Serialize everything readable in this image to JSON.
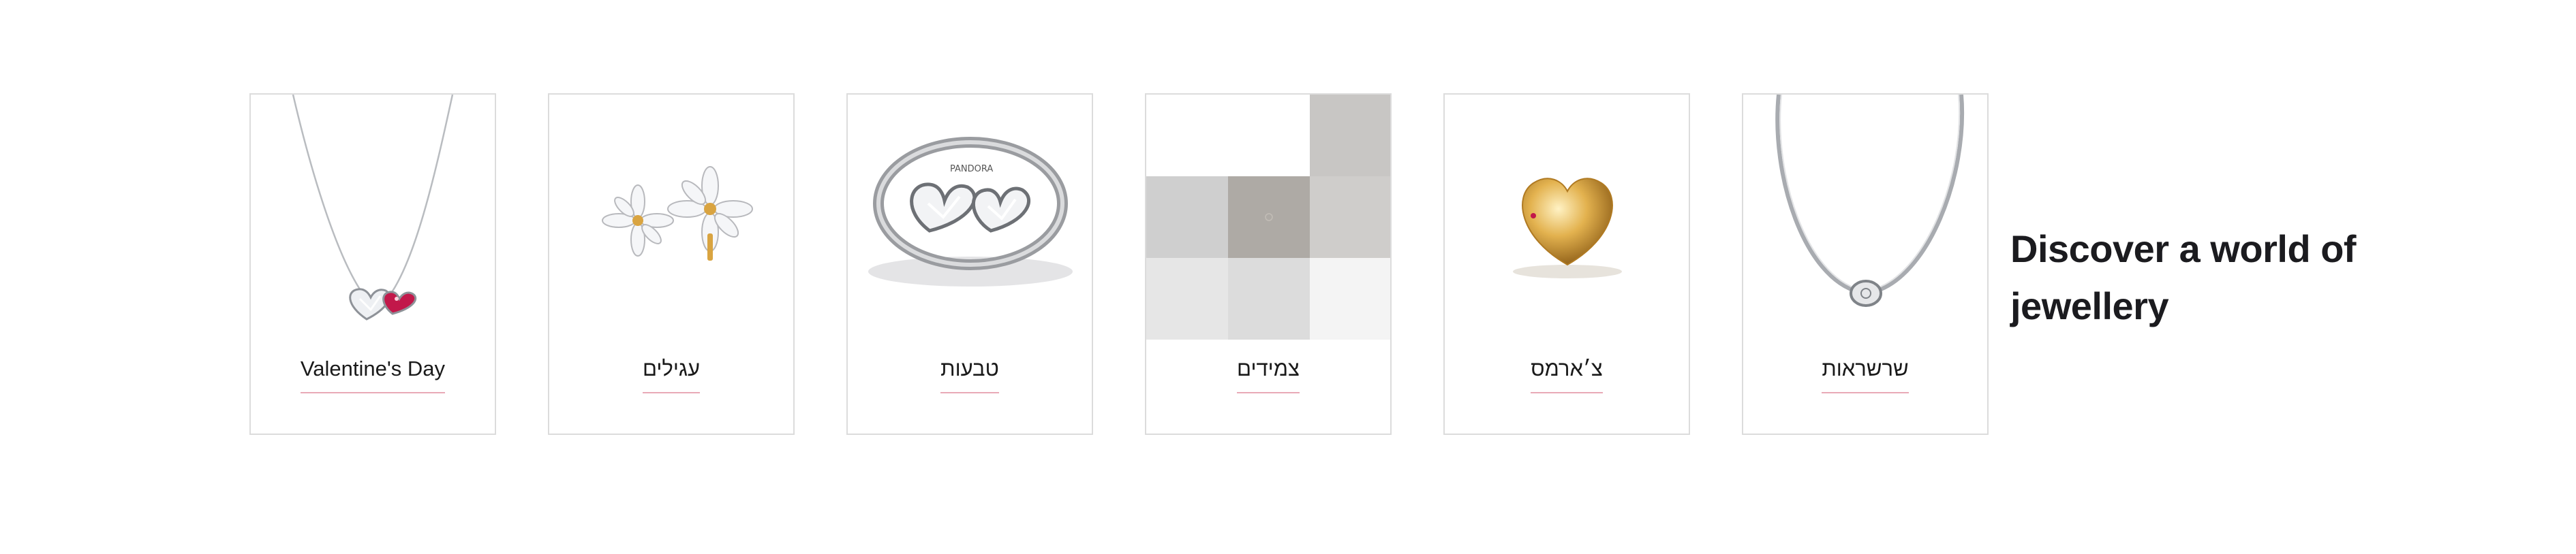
{
  "section": {
    "heading": "Discover a world of jewellery"
  },
  "categories": [
    {
      "label": "Valentine's Day",
      "image": "heart-necklace-image"
    },
    {
      "label": "עגילים",
      "image": "flower-earrings-image"
    },
    {
      "label": "טבעות",
      "image": "double-heart-ring-image"
    },
    {
      "label": "צמידים",
      "image": "placeholder-mosaic-image"
    },
    {
      "label": "צ׳ארמס",
      "image": "gold-heart-charm-image"
    },
    {
      "label": "שרשראות",
      "image": "snake-chain-necklace-image"
    }
  ],
  "colors": {
    "underline": "#e9a9b6",
    "border": "#dcdcdc",
    "heading": "#1b1b1f",
    "ruby": "#c2184a",
    "gold": "#d9a441"
  }
}
